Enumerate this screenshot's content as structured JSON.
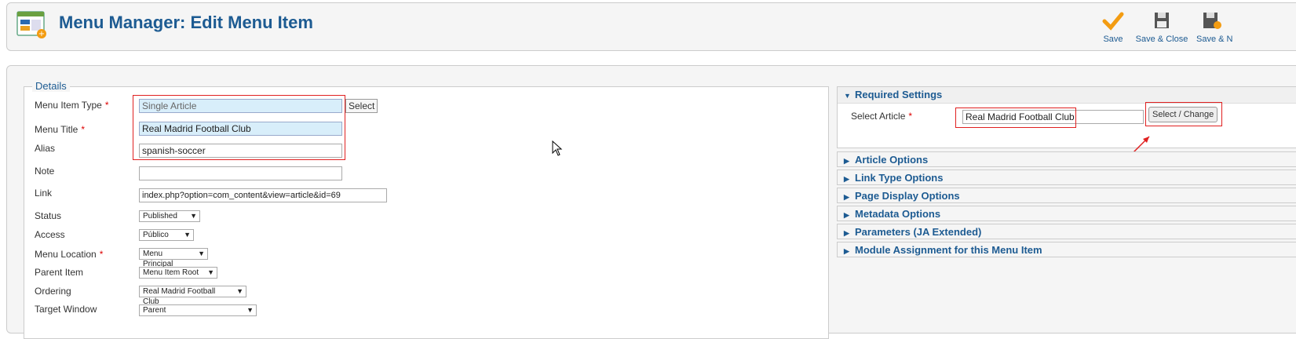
{
  "header": {
    "title": "Menu Manager: Edit Menu Item"
  },
  "toolbar": {
    "save": "Save",
    "save_close": "Save & Close",
    "save_new": "Save & N"
  },
  "details": {
    "legend": "Details",
    "menu_item_type": {
      "label": "Menu Item Type",
      "value": "Single Article",
      "button": "Select"
    },
    "menu_title": {
      "label": "Menu Title",
      "value": "Real Madrid Football Club"
    },
    "alias": {
      "label": "Alias",
      "value": "spanish-soccer"
    },
    "note": {
      "label": "Note",
      "value": ""
    },
    "link": {
      "label": "Link",
      "value": "index.php?option=com_content&view=article&id=69"
    },
    "status": {
      "label": "Status",
      "value": "Published"
    },
    "access": {
      "label": "Access",
      "value": "Público"
    },
    "menu_location": {
      "label": "Menu Location",
      "value": "Menu Principal"
    },
    "parent_item": {
      "label": "Parent Item",
      "value": "Menu Item Root"
    },
    "ordering": {
      "label": "Ordering",
      "value": "Real Madrid Football Club"
    },
    "target_window": {
      "label": "Target Window",
      "value": "Parent"
    },
    "required_mark": "*"
  },
  "required_settings": {
    "title": "Required Settings",
    "select_article_label": "Select Article",
    "select_article_value": "Real Madrid Football Club",
    "select_change_button": "Select / Change"
  },
  "panels": [
    "Article Options",
    "Link Type Options",
    "Page Display Options",
    "Metadata Options",
    "Parameters (JA Extended)",
    "Module Assignment for this Menu Item"
  ],
  "colors": {
    "title_blue": "#1d5b92",
    "annotation_red": "#e02020",
    "save_orange": "#f39c12"
  }
}
